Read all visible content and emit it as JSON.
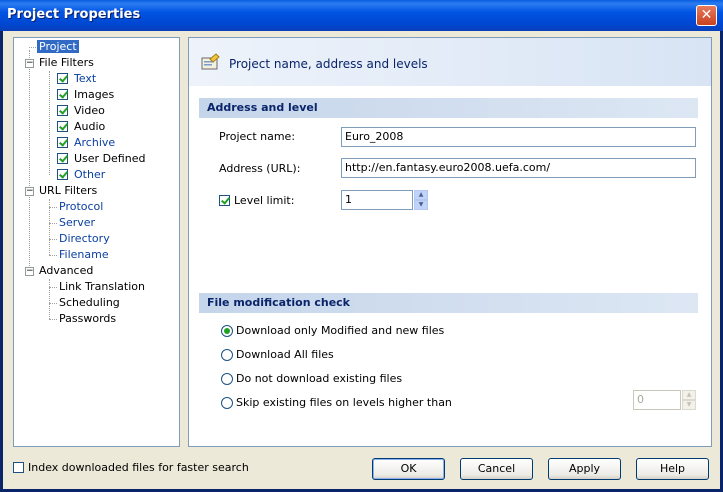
{
  "window": {
    "title": "Project Properties",
    "close_glyph": "✕"
  },
  "tree": {
    "items": [
      {
        "label": "Project",
        "level": 0,
        "selected": true
      },
      {
        "label": "File Filters",
        "level": 0,
        "expander": "-"
      },
      {
        "label": "Text",
        "level": 1,
        "checkbox": true
      },
      {
        "label": "Images",
        "level": 1,
        "checkbox": true
      },
      {
        "label": "Video",
        "level": 1,
        "checkbox": true
      },
      {
        "label": "Audio",
        "level": 1,
        "checkbox": true
      },
      {
        "label": "Archive",
        "level": 1,
        "checkbox": true
      },
      {
        "label": "User Defined",
        "level": 1,
        "checkbox": true
      },
      {
        "label": "Other",
        "level": 1,
        "checkbox": true
      },
      {
        "label": "URL Filters",
        "level": 0,
        "expander": "-"
      },
      {
        "label": "Protocol",
        "level": 1
      },
      {
        "label": "Server",
        "level": 1
      },
      {
        "label": "Directory",
        "level": 1
      },
      {
        "label": "Filename",
        "level": 1
      },
      {
        "label": "Advanced",
        "level": 0,
        "expander": "-"
      },
      {
        "label": "Link Translation",
        "level": 1
      },
      {
        "label": "Scheduling",
        "level": 1
      },
      {
        "label": "Passwords",
        "level": 1
      }
    ]
  },
  "panel": {
    "header_title": "Project name, address and levels",
    "icon": "project-properties-icon",
    "section1": "Address and level",
    "project_name_label": "Project name:",
    "project_name_value": "Euro_2008",
    "address_label": "Address (URL):",
    "address_value": "http://en.fantasy.euro2008.uefa.com/",
    "level_limit_label": "Level limit:",
    "level_limit_checked": true,
    "level_limit_value": "1",
    "section2": "File modification check",
    "radios": [
      {
        "label": "Download only Modified and new files",
        "checked": true
      },
      {
        "label": "Download All files",
        "checked": false
      },
      {
        "label": "Do not download existing files",
        "checked": false
      },
      {
        "label": "Skip existing files on levels higher than",
        "checked": false
      }
    ],
    "skip_level_value": "0"
  },
  "footer": {
    "index_label": "Index downloaded files for faster search",
    "index_checked": false,
    "ok": "OK",
    "cancel": "Cancel",
    "apply": "Apply",
    "help": "Help"
  },
  "colors": {
    "title_bar": "#0054e3",
    "selection": "#316ac5",
    "section_text": "#0a246a"
  }
}
